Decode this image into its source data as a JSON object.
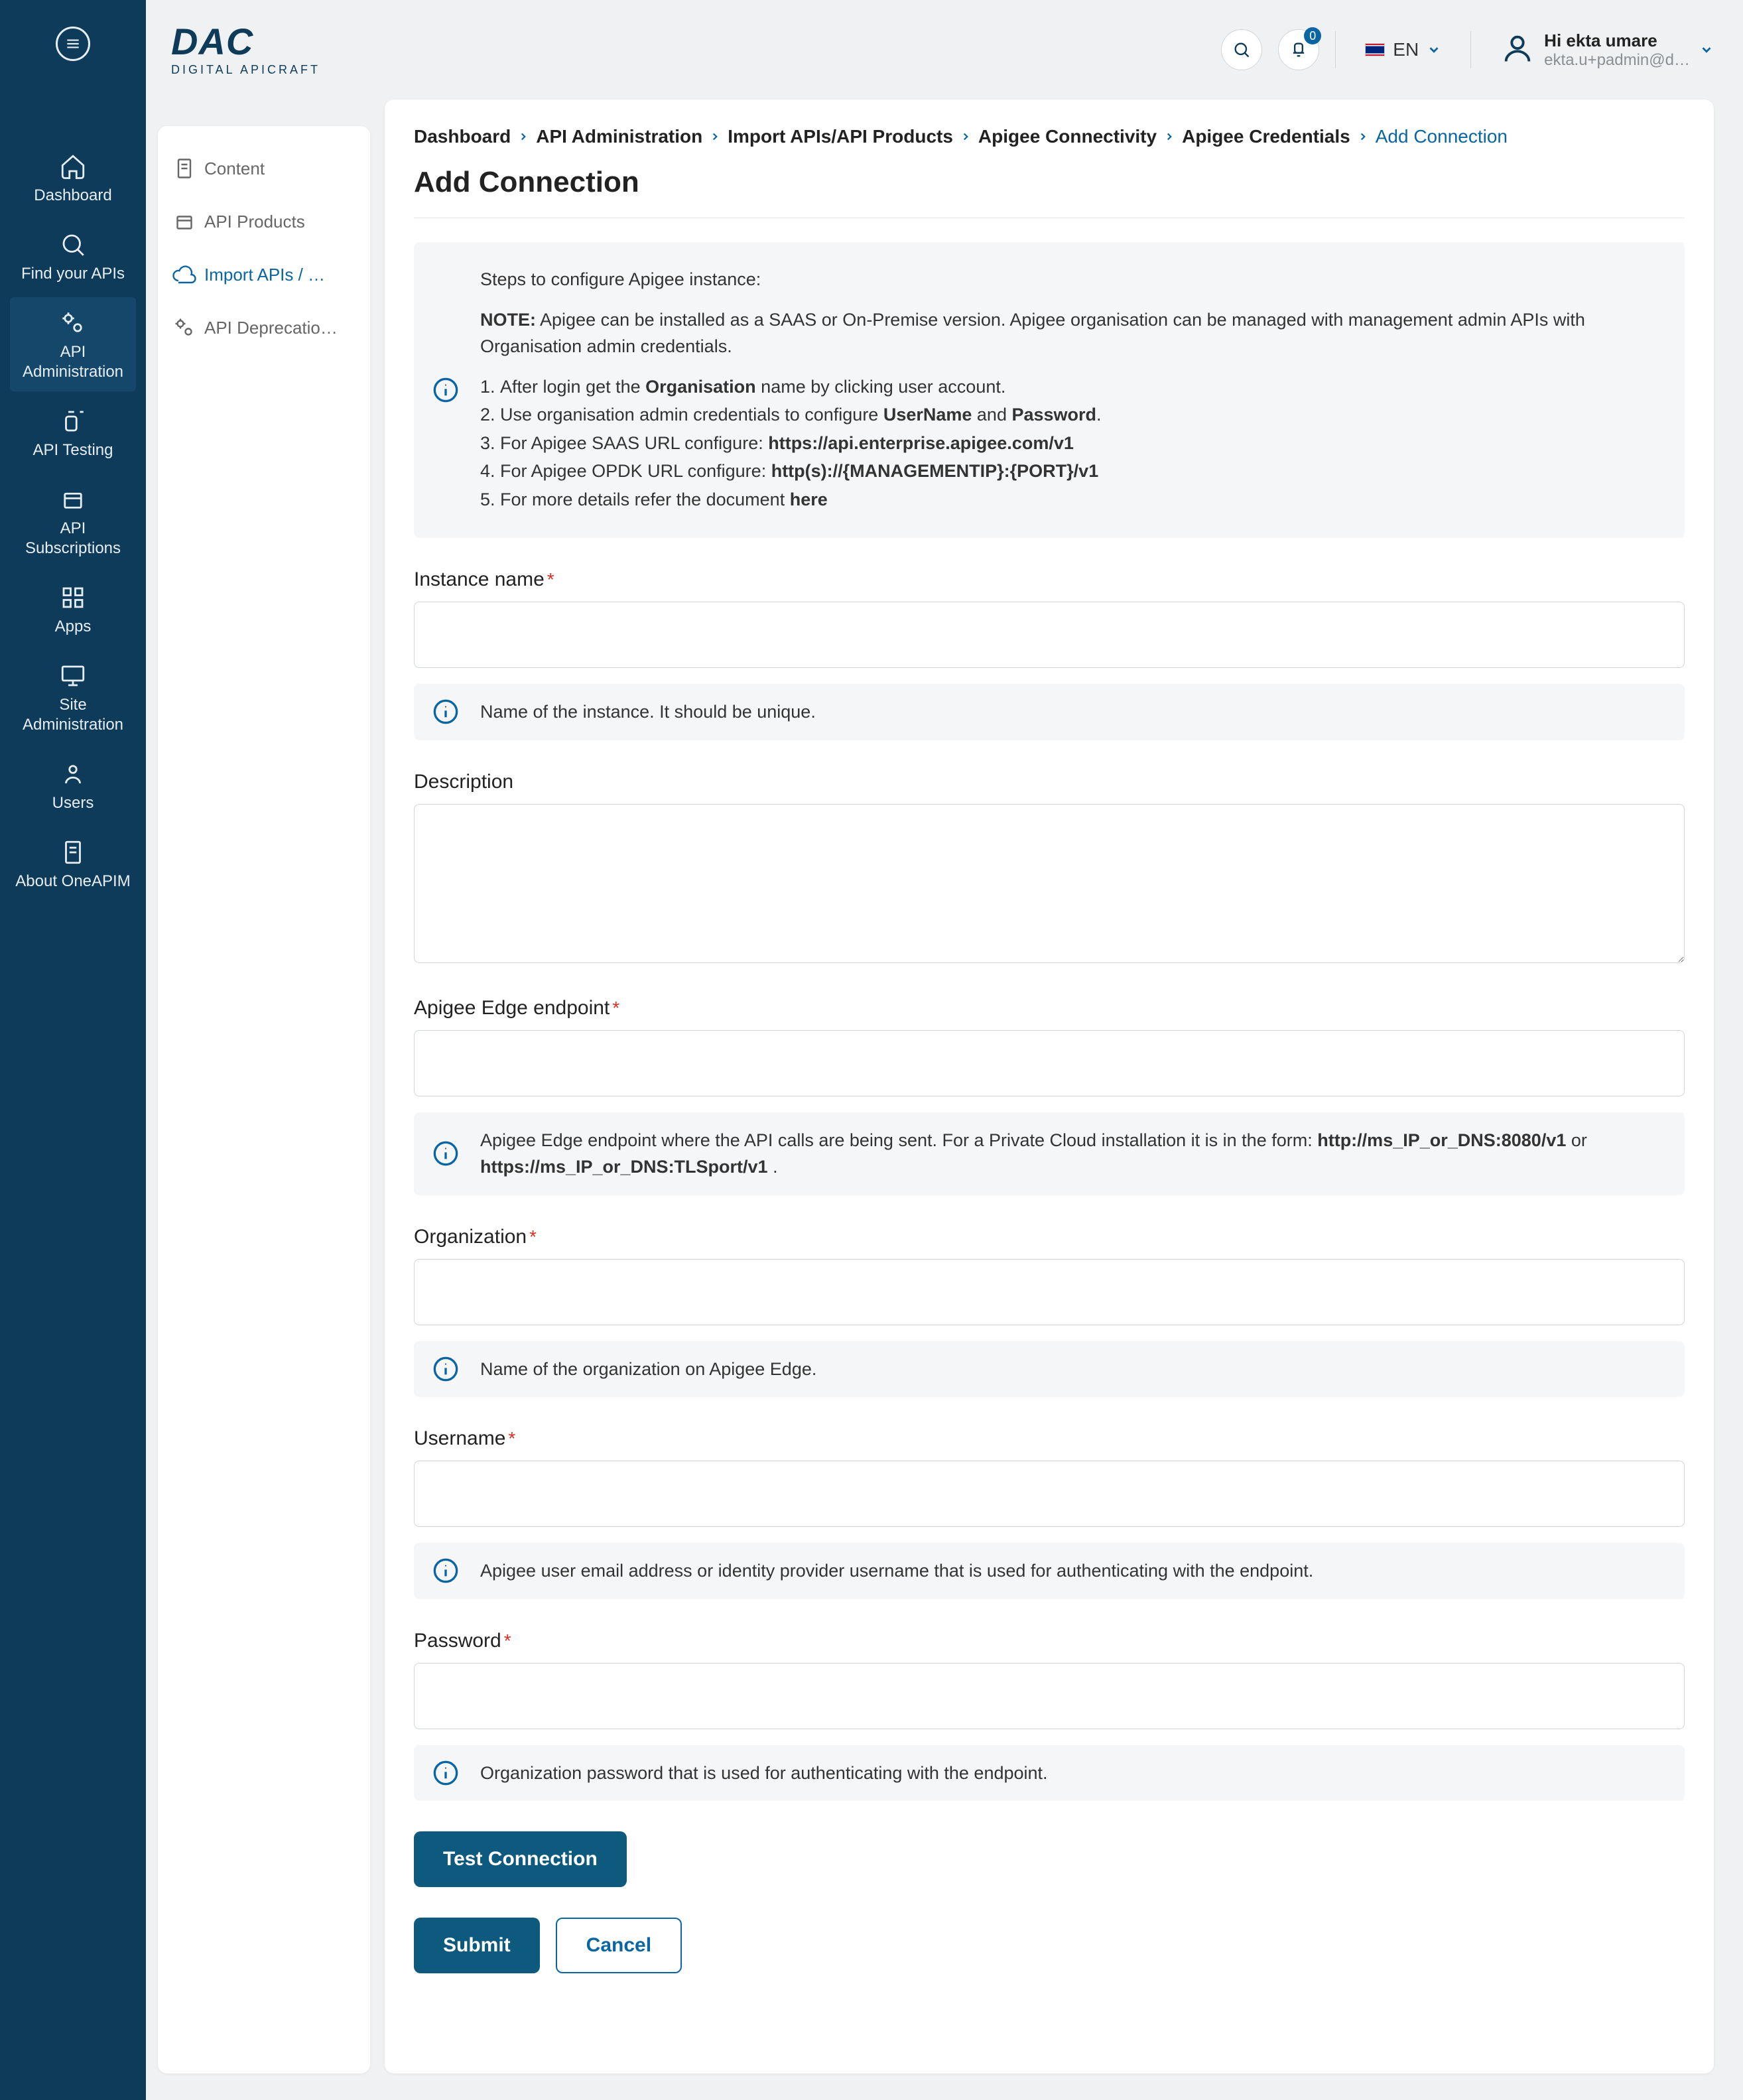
{
  "brand": {
    "name": "DAC",
    "tagline": "DIGITAL APICRAFT"
  },
  "header": {
    "search_aria": "Search",
    "notif_badge": "0",
    "lang_label": "EN",
    "user_greeting": "Hi ekta umare",
    "user_email": "ekta.u+padmin@d…"
  },
  "nav": {
    "items": [
      {
        "label": "Dashboard"
      },
      {
        "label": "Find your APIs"
      },
      {
        "label": "API Administration"
      },
      {
        "label": "API Testing"
      },
      {
        "label": "API Subscriptions"
      },
      {
        "label": "Apps"
      },
      {
        "label": "Site Administration"
      },
      {
        "label": "Users"
      },
      {
        "label": "About OneAPIM"
      }
    ]
  },
  "subnav": {
    "items": [
      {
        "label": "Content"
      },
      {
        "label": "API Products"
      },
      {
        "label": "Import APIs / …"
      },
      {
        "label": "API Deprecatio…"
      }
    ]
  },
  "breadcrumb": {
    "items": [
      "Dashboard",
      "API Administration",
      "Import APIs/API Products",
      "Apigee Connectivity",
      "Apigee Credentials"
    ],
    "current": "Add Connection"
  },
  "page": {
    "title": "Add Connection"
  },
  "steps_box": {
    "heading": "Steps to configure Apigee instance:",
    "note_label": "NOTE:",
    "note_text": " Apigee can be installed as a SAAS or On-Premise version. Apigee organisation can be managed with management admin APIs with Organisation admin credentials.",
    "li1_a": "After login get the ",
    "li1_b": "Organisation",
    "li1_c": " name by clicking user account.",
    "li2_a": "Use organisation admin credentials to configure ",
    "li2_b": "UserName",
    "li2_c": " and ",
    "li2_d": "Password",
    "li2_e": ".",
    "li3_a": "For Apigee SAAS URL configure: ",
    "li3_b": "https://api.enterprise.apigee.com/v1",
    "li4_a": "For Apigee OPDK URL configure: ",
    "li4_b": "http(s)://{MANAGEMENTIP}:{PORT}/v1",
    "li5_a": "For more details refer the document ",
    "li5_b": "here"
  },
  "form": {
    "instance_label": "Instance name",
    "instance_hint": "Name of the instance. It should be unique.",
    "desc_label": "Description",
    "endpoint_label": "Apigee Edge endpoint",
    "endpoint_hint_a": "Apigee Edge endpoint where the API calls are being sent. For a Private Cloud installation it is in the form:  ",
    "endpoint_hint_b": "http://ms_IP_or_DNS:8080/v1",
    "endpoint_hint_c": "  or  ",
    "endpoint_hint_d": "https://ms_IP_or_DNS:TLSport/v1",
    "endpoint_hint_e": " .",
    "org_label": "Organization",
    "org_hint": "Name of the organization on Apigee Edge.",
    "user_label": "Username",
    "user_hint": "Apigee user email address or identity provider username that is used for authenticating with the endpoint.",
    "pass_label": "Password",
    "pass_hint": "Organization password that is used for authenticating with the endpoint.",
    "test_btn": "Test Connection",
    "submit_btn": "Submit",
    "cancel_btn": "Cancel"
  }
}
